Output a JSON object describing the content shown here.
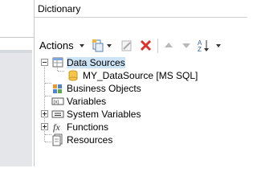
{
  "panel": {
    "title": "Dictionary"
  },
  "toolbar": {
    "actions_label": "Actions",
    "new_icon": "new-item-icon",
    "edit_icon": "edit-icon",
    "delete_icon": "delete-icon",
    "up_icon": "arrow-up-icon",
    "down_icon": "arrow-down-icon",
    "sort_icon": "sort-az-icon",
    "delete_color": "#d9342b"
  },
  "tree": {
    "items": [
      {
        "label": "Data Sources",
        "icon": "data-sources-icon",
        "expanded": true,
        "selected": true
      },
      {
        "label": "MY_DataSource [MS SQL]",
        "icon": "database-icon"
      },
      {
        "label": "Business Objects",
        "icon": "business-objects-icon"
      },
      {
        "label": "Variables",
        "icon": "variables-icon"
      },
      {
        "label": "System Variables",
        "icon": "system-variables-icon",
        "expandable": true
      },
      {
        "label": "Functions",
        "icon": "functions-icon",
        "expandable": true
      },
      {
        "label": "Resources",
        "icon": "resources-icon"
      }
    ]
  }
}
